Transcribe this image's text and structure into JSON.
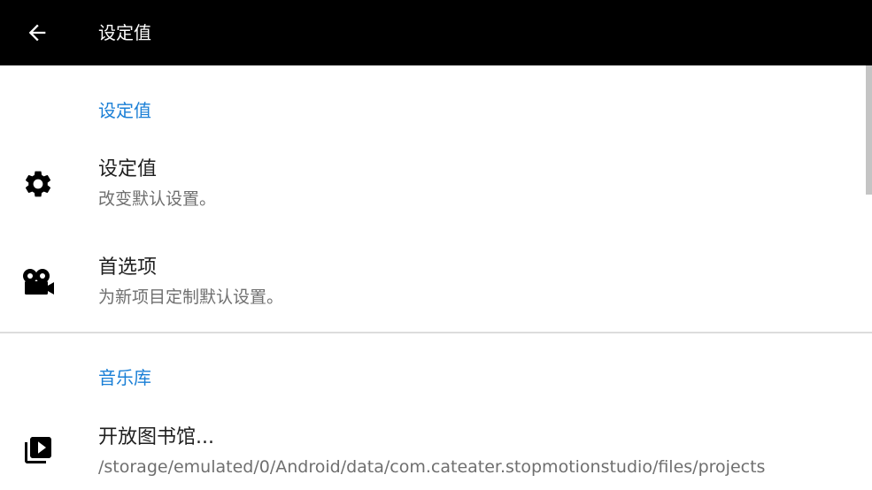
{
  "toolbar": {
    "back_icon": "arrow-back-icon",
    "title": "设定值"
  },
  "sections": [
    {
      "header": "设定值",
      "items": [
        {
          "icon": "gear-icon",
          "title": "设定值",
          "summary": "改变默认设置。"
        },
        {
          "icon": "movie-camera-icon",
          "title": "首选项",
          "summary": "为新项目定制默认设置。"
        }
      ]
    },
    {
      "header": "音乐库",
      "items": [
        {
          "icon": "video-library-icon",
          "title": "开放图书馆...",
          "summary": "/storage/emulated/0/Android/data/com.cateater.stopmotionstudio/files/projects"
        }
      ]
    }
  ],
  "colors": {
    "toolbar_bg": "#000000",
    "accent": "#1a7fd6",
    "title_text": "#1f1f1f",
    "summary_text": "#6f6f6f",
    "divider": "#dcdcdc"
  }
}
